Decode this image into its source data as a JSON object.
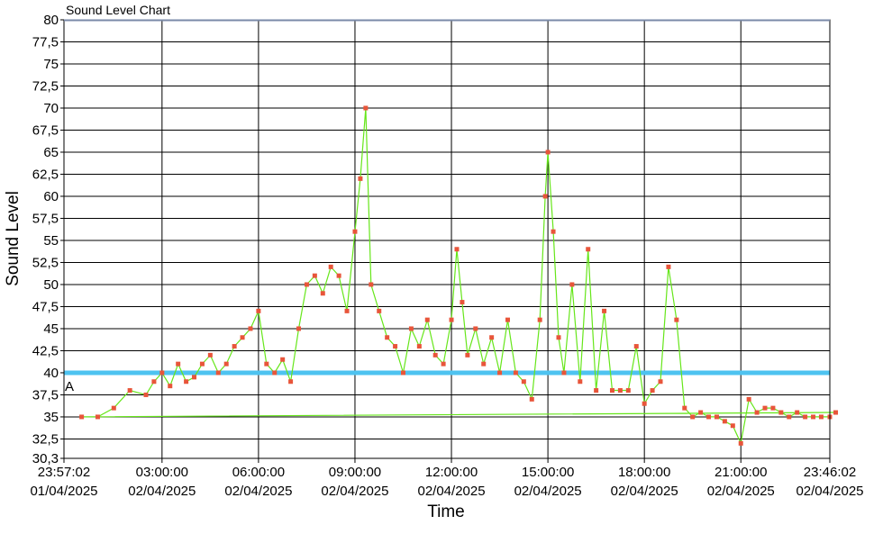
{
  "chart_data": {
    "type": "line",
    "title": "Sound Level Chart",
    "xlabel": "Time",
    "ylabel": "Sound Level",
    "ylim": [
      30.3,
      80
    ],
    "y_ticks": [
      "30,3",
      "32,5",
      "35",
      "37,5",
      "40",
      "42,5",
      "45",
      "47,5",
      "50",
      "52,5",
      "55",
      "57,5",
      "60",
      "62,5",
      "65",
      "67,5",
      "70",
      "72,5",
      "75",
      "77,5",
      "80"
    ],
    "x_ticks": [
      {
        "time": "23:57:02",
        "date": "01/04/2025"
      },
      {
        "time": "03:00:00",
        "date": "02/04/2025"
      },
      {
        "time": "06:00:00",
        "date": "02/04/2025"
      },
      {
        "time": "09:00:00",
        "date": "02/04/2025"
      },
      {
        "time": "12:00:00",
        "date": "02/04/2025"
      },
      {
        "time": "15:00:00",
        "date": "02/04/2025"
      },
      {
        "time": "18:00:00",
        "date": "02/04/2025"
      },
      {
        "time": "21:00:00",
        "date": "02/04/2025"
      },
      {
        "time": "23:46:02",
        "date": "02/04/2025"
      }
    ],
    "x_range": [
      "01/04/2025 23:57:02",
      "02/04/2025 23:46:02"
    ],
    "grid": true,
    "threshold": {
      "value": 40,
      "color": "#4ec3f0"
    },
    "marker_label": "A",
    "series": [
      {
        "color": "#66e61a",
        "marker_color": "#e8553a",
        "x": [
          "23:57",
          "00:30",
          "01:00",
          "01:30",
          "02:00",
          "02:30",
          "02:45",
          "03:00",
          "03:15",
          "03:30",
          "03:45",
          "04:00",
          "04:15",
          "04:30",
          "04:45",
          "05:00",
          "05:15",
          "05:30",
          "05:45",
          "06:00",
          "06:15",
          "06:30",
          "06:45",
          "07:00",
          "07:15",
          "07:30",
          "07:45",
          "08:00",
          "08:15",
          "08:30",
          "08:45",
          "09:00",
          "09:10",
          "09:20",
          "09:30",
          "09:45",
          "10:00",
          "10:15",
          "10:30",
          "10:45",
          "11:00",
          "11:15",
          "11:30",
          "11:45",
          "12:00",
          "12:10",
          "12:20",
          "12:30",
          "12:45",
          "13:00",
          "13:15",
          "13:30",
          "13:45",
          "14:00",
          "14:15",
          "14:30",
          "14:45",
          "14:55",
          "15:00",
          "15:10",
          "15:20",
          "15:30",
          "15:45",
          "16:00",
          "16:15",
          "16:30",
          "16:45",
          "17:00",
          "17:15",
          "17:30",
          "17:45",
          "18:00",
          "18:15",
          "18:30",
          "18:45",
          "19:00",
          "19:15",
          "19:30",
          "19:45",
          "20:00",
          "20:15",
          "20:30",
          "20:45",
          "21:00",
          "21:15",
          "21:30",
          "21:45",
          "22:00",
          "22:15",
          "22:30",
          "22:45",
          "23:00",
          "23:15",
          "23:30",
          "23:46"
        ],
        "values": [
          35.5,
          35,
          35,
          36,
          38,
          37.5,
          39,
          40,
          38.5,
          41,
          39,
          39.5,
          41,
          42,
          40,
          41,
          43,
          44,
          45,
          47,
          41,
          40,
          41.5,
          39,
          45,
          50,
          51,
          49,
          52,
          51,
          47,
          56,
          62,
          70,
          50,
          47,
          44,
          43,
          40,
          45,
          43,
          46,
          42,
          41,
          46,
          54,
          48,
          42,
          45,
          41,
          44,
          40,
          46,
          40,
          39,
          37,
          46,
          60,
          65,
          56,
          44,
          40,
          50,
          39,
          54,
          38,
          47,
          38,
          38,
          38,
          43,
          36.5,
          38,
          39,
          52,
          46,
          36,
          35,
          35.5,
          35,
          35,
          34.5,
          34,
          32,
          37,
          35.5,
          36,
          36,
          35.5,
          35,
          35.5,
          35,
          35,
          35,
          35
        ]
      }
    ]
  }
}
